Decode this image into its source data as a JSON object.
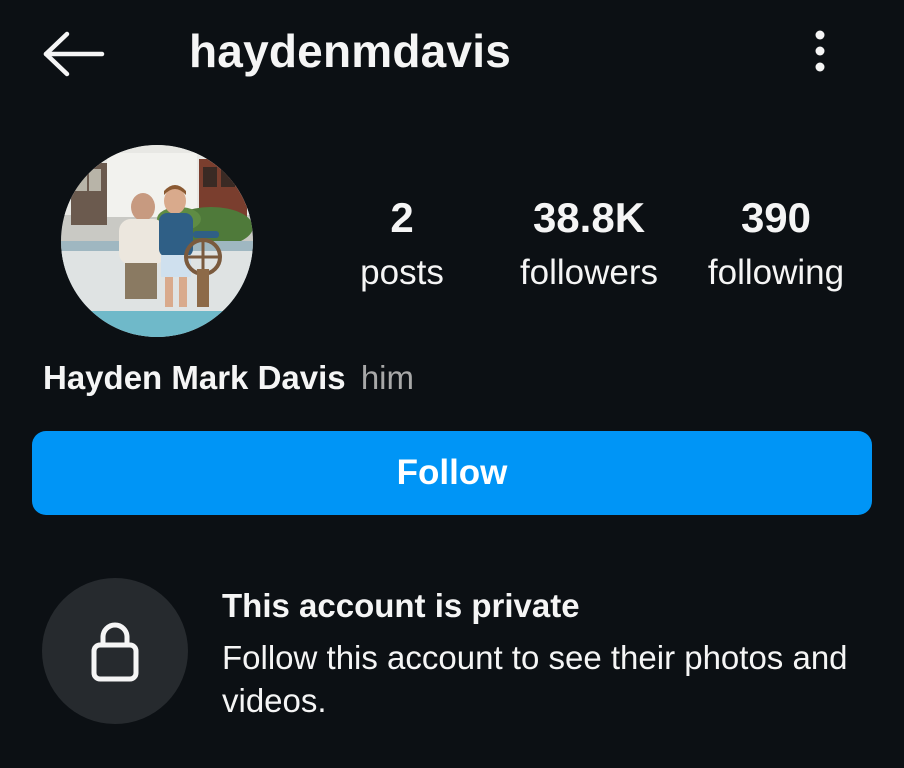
{
  "header": {
    "back_icon": "arrow-left-icon",
    "username": "haydenmdavis",
    "more_icon": "vertical-ellipsis-icon"
  },
  "profile": {
    "avatar": "profile-photo",
    "stats": {
      "posts": {
        "value": "2",
        "label": "posts"
      },
      "followers": {
        "value": "38.8K",
        "label": "followers"
      },
      "following": {
        "value": "390",
        "label": "following"
      }
    },
    "full_name": "Hayden Mark Davis",
    "pronouns": "him"
  },
  "actions": {
    "follow_label": "Follow"
  },
  "private_notice": {
    "icon": "lock-icon",
    "title": "This account is private",
    "description": "Follow this account to see their photos and videos."
  },
  "colors": {
    "background": "#0c1014",
    "accent": "#0095f6",
    "text": "#f5f5f5",
    "muted": "#a8a8a8",
    "lock_circle": "#262a2e"
  }
}
